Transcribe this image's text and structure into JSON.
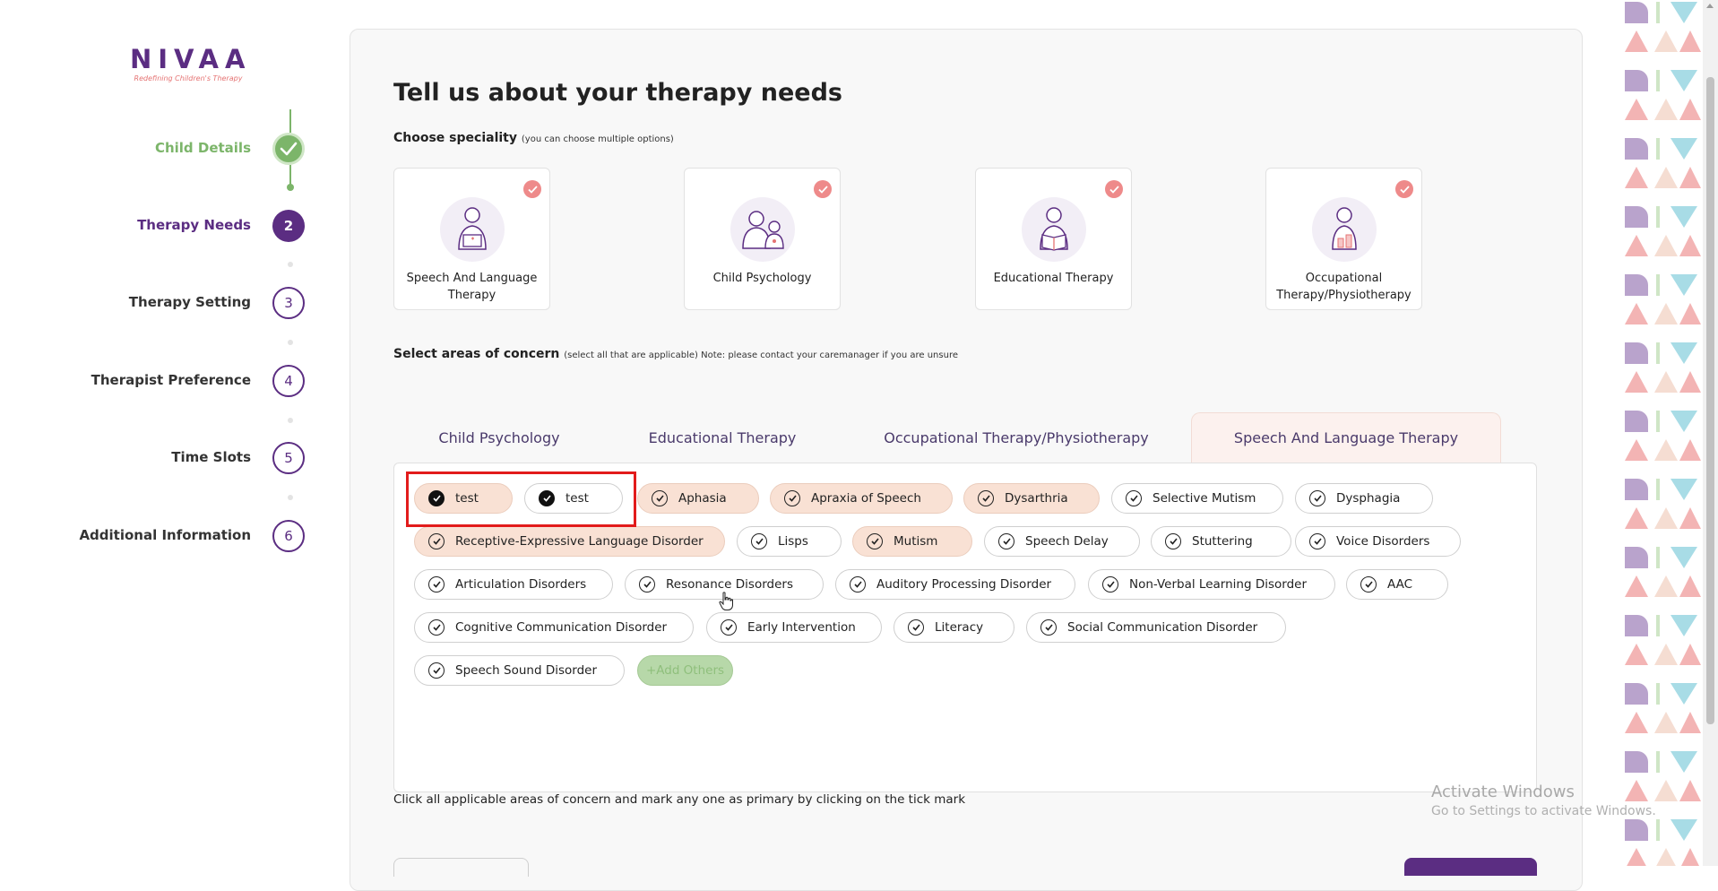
{
  "logo": {
    "name": "NIVAA",
    "tagline": "Redefining Children's Therapy"
  },
  "steps": [
    {
      "label": "Child Details",
      "number": "",
      "state": "done"
    },
    {
      "label": "Therapy Needs",
      "number": "2",
      "state": "active"
    },
    {
      "label": "Therapy Setting",
      "number": "3",
      "state": "todo"
    },
    {
      "label": "Therapist Preference",
      "number": "4",
      "state": "todo"
    },
    {
      "label": "Time Slots",
      "number": "5",
      "state": "todo"
    },
    {
      "label": "Additional Information",
      "number": "6",
      "state": "todo"
    }
  ],
  "page": {
    "title": "Tell us about your therapy needs",
    "speciality_heading": "Choose speciality",
    "speciality_hint": "(you can choose multiple options)",
    "concern_heading": "Select areas of concern",
    "concern_hint": "(select all that are applicable) Note: please contact your caremanager if you are unsure",
    "footer_note": "Click all applicable areas of concern and mark any one as primary by clicking on the tick mark"
  },
  "specialities": [
    {
      "label": "Speech And Language Therapy",
      "icon": "speech-therapy-icon",
      "selected": true
    },
    {
      "label": "Child Psychology",
      "icon": "child-psychology-icon",
      "selected": true
    },
    {
      "label": "Educational Therapy",
      "icon": "educational-therapy-icon",
      "selected": true
    },
    {
      "label": "Occupational Therapy/Physiotherapy",
      "icon": "occupational-therapy-icon",
      "selected": true
    }
  ],
  "tabs": [
    {
      "label": "Child Psychology",
      "active": false
    },
    {
      "label": "Educational Therapy",
      "active": false
    },
    {
      "label": "Occupational Therapy/Physiotherapy",
      "active": false
    },
    {
      "label": "Speech And Language Therapy",
      "active": true
    }
  ],
  "concerns": [
    {
      "label": "test",
      "selected": true,
      "primary": true
    },
    {
      "label": "test",
      "selected": false,
      "primary": true
    },
    {
      "label": "Aphasia",
      "selected": true,
      "primary": false
    },
    {
      "label": "Apraxia of Speech",
      "selected": true,
      "primary": false
    },
    {
      "label": "Dysarthria",
      "selected": true,
      "primary": false
    },
    {
      "label": "Selective Mutism",
      "selected": false,
      "primary": false
    },
    {
      "label": "Dysphagia",
      "selected": false,
      "primary": false
    },
    {
      "label": "Receptive-Expressive Language Disorder",
      "selected": true,
      "primary": false
    },
    {
      "label": "Lisps",
      "selected": false,
      "primary": false
    },
    {
      "label": "Mutism",
      "selected": true,
      "primary": false
    },
    {
      "label": "Speech Delay",
      "selected": false,
      "primary": false
    },
    {
      "label": "Stuttering",
      "selected": false,
      "primary": false
    },
    {
      "label": "Voice Disorders",
      "selected": false,
      "primary": false
    },
    {
      "label": "Articulation Disorders",
      "selected": false,
      "primary": false
    },
    {
      "label": "Resonance Disorders",
      "selected": false,
      "primary": false
    },
    {
      "label": "Auditory Processing Disorder",
      "selected": false,
      "primary": false
    },
    {
      "label": "Non-Verbal Learning Disorder",
      "selected": false,
      "primary": false
    },
    {
      "label": "AAC",
      "selected": false,
      "primary": false
    },
    {
      "label": "Cognitive Communication Disorder",
      "selected": false,
      "primary": false
    },
    {
      "label": "Early Intervention",
      "selected": false,
      "primary": false
    },
    {
      "label": "Literacy",
      "selected": false,
      "primary": false
    },
    {
      "label": "Social Communication Disorder",
      "selected": false,
      "primary": false
    },
    {
      "label": "Speech Sound Disorder",
      "selected": false,
      "primary": false
    }
  ],
  "add_others_label": "+Add Others",
  "watermark": {
    "line1": "Activate Windows",
    "line2": "Go to Settings to activate Windows."
  },
  "colors": {
    "brand_purple": "#5b2d82",
    "done_green": "#7cb56a",
    "selected_chip": "#f9e1d4",
    "check_pink": "#ee8a8a",
    "highlight_red": "#e21b1b"
  }
}
